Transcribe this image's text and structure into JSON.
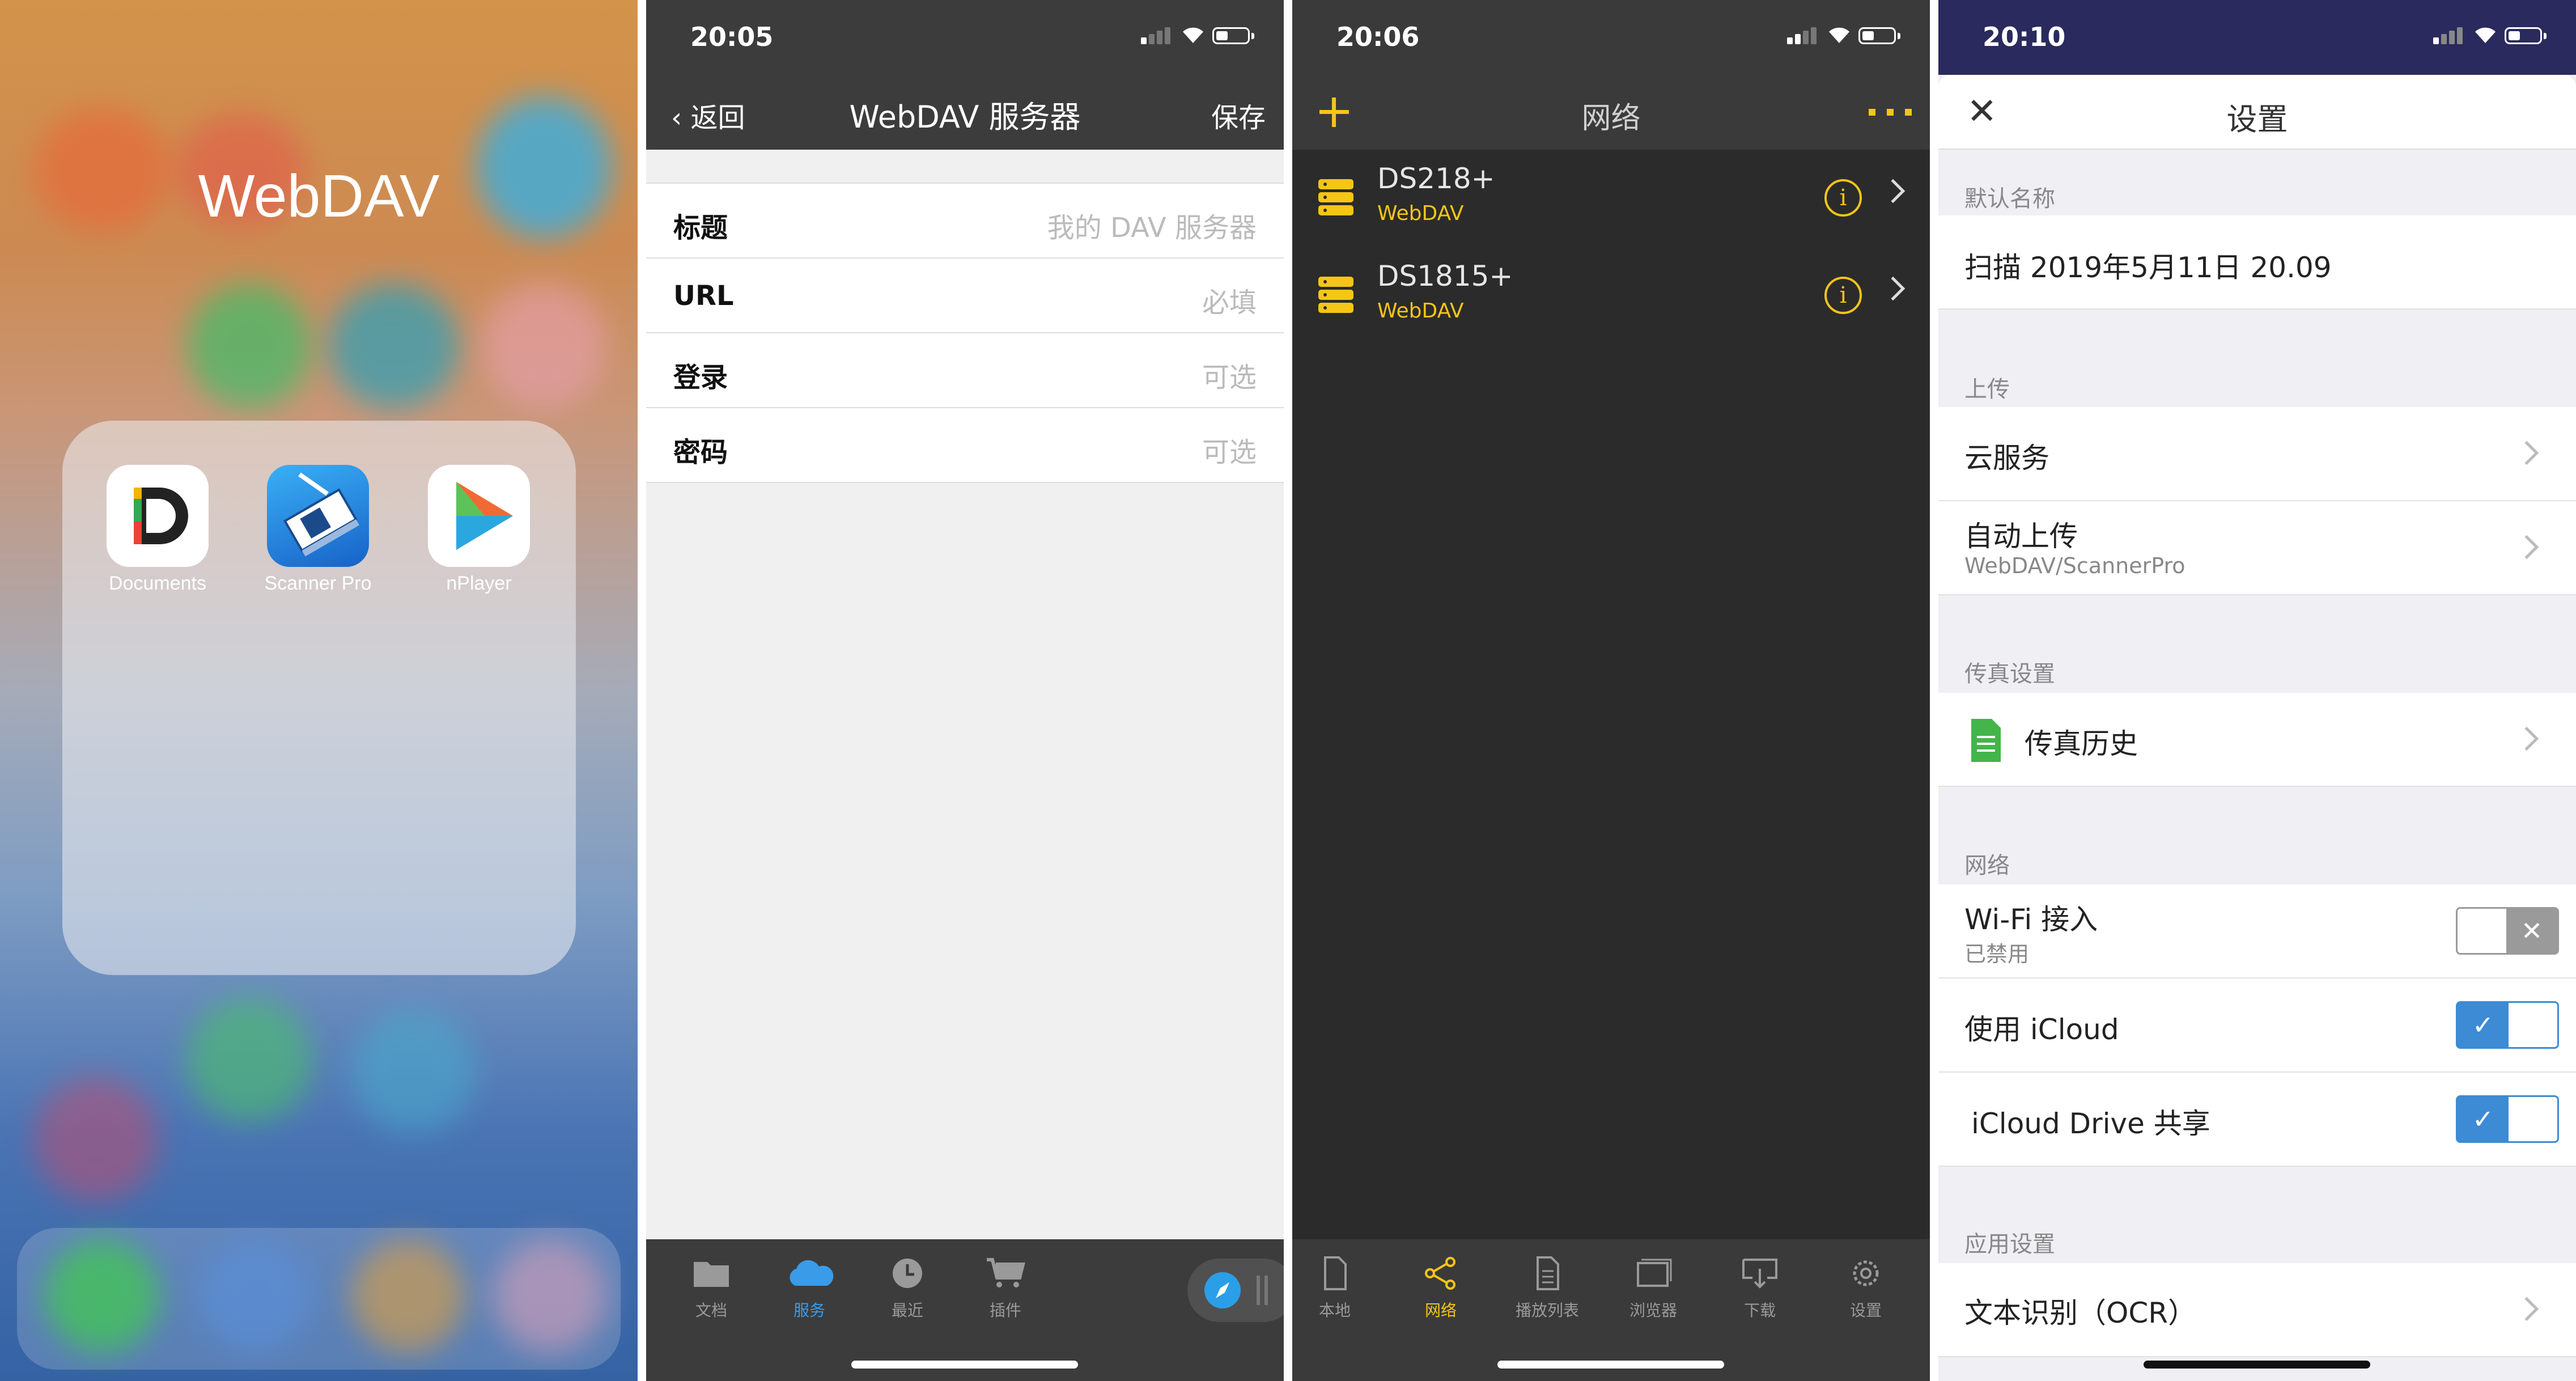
{
  "panel1": {
    "folder_title": "WebDAV",
    "apps": [
      {
        "label": "Documents",
        "icon": "documents-app-icon"
      },
      {
        "label": "Scanner Pro",
        "icon": "scanner-pro-app-icon"
      },
      {
        "label": "nPlayer",
        "icon": "nplayer-app-icon"
      }
    ]
  },
  "panel2": {
    "time": "20:05",
    "back_label": "返回",
    "title": "WebDAV 服务器",
    "save_label": "保存",
    "fields": [
      {
        "label": "标题",
        "placeholder": "我的 DAV 服务器"
      },
      {
        "label": "URL",
        "placeholder": "必填"
      },
      {
        "label": "登录",
        "placeholder": "可选"
      },
      {
        "label": "密码",
        "placeholder": "可选"
      }
    ],
    "tabs": [
      {
        "label": "文档",
        "icon": "folder-icon",
        "active": false
      },
      {
        "label": "服务",
        "icon": "cloud-icon",
        "active": true
      },
      {
        "label": "最近",
        "icon": "clock-icon",
        "active": false
      },
      {
        "label": "插件",
        "icon": "cart-icon",
        "active": false
      }
    ],
    "accent": "#3a9be8"
  },
  "panel3": {
    "time": "20:06",
    "title": "网络",
    "servers": [
      {
        "name": "DS218+",
        "type": "WebDAV"
      },
      {
        "name": "DS1815+",
        "type": "WebDAV"
      }
    ],
    "tabs": [
      {
        "label": "本地",
        "icon": "file-icon",
        "active": false
      },
      {
        "label": "网络",
        "icon": "share-icon",
        "active": true
      },
      {
        "label": "播放列表",
        "icon": "playlist-icon",
        "active": false
      },
      {
        "label": "浏览器",
        "icon": "browser-icon",
        "active": false
      },
      {
        "label": "下载",
        "icon": "download-icon",
        "active": false
      },
      {
        "label": "设置",
        "icon": "gear-icon",
        "active": false
      }
    ],
    "accent": "#f5c518"
  },
  "panel4": {
    "time": "20:10",
    "title": "设置",
    "sections": {
      "default_name": "默认名称",
      "upload": "上传",
      "fax": "传真设置",
      "network": "网络",
      "app": "应用设置"
    },
    "default_name_value": "扫描 2019年5月11日 20.09",
    "cloud_service": "云服务",
    "auto_upload": "自动上传",
    "auto_upload_sub": "WebDAV/ScannerPro",
    "fax_history": "传真历史",
    "wifi": "Wi-Fi 接入",
    "wifi_sub": "已禁用",
    "wifi_on": false,
    "icloud": "使用 iCloud",
    "icloud_on": true,
    "icloud_drive": "iCloud Drive 共享",
    "icloud_drive_on": true,
    "ocr": "文本识别（OCR）",
    "accent": "#3d8bd4"
  }
}
